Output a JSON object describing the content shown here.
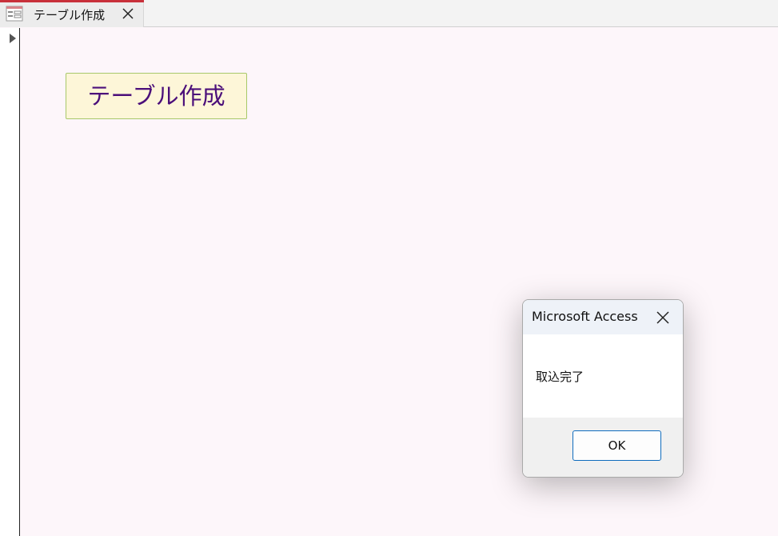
{
  "tab": {
    "title": "テーブル作成",
    "icon": "form-icon",
    "close_icon": "close-icon",
    "accent_color": "#c8303a"
  },
  "form": {
    "label": "テーブル作成",
    "label_color": "#4b0f7a",
    "label_background": "#fdf6d8"
  },
  "dialog": {
    "title": "Microsoft Access",
    "message": "取込完了",
    "ok_label": "OK",
    "close_icon": "close-icon"
  }
}
